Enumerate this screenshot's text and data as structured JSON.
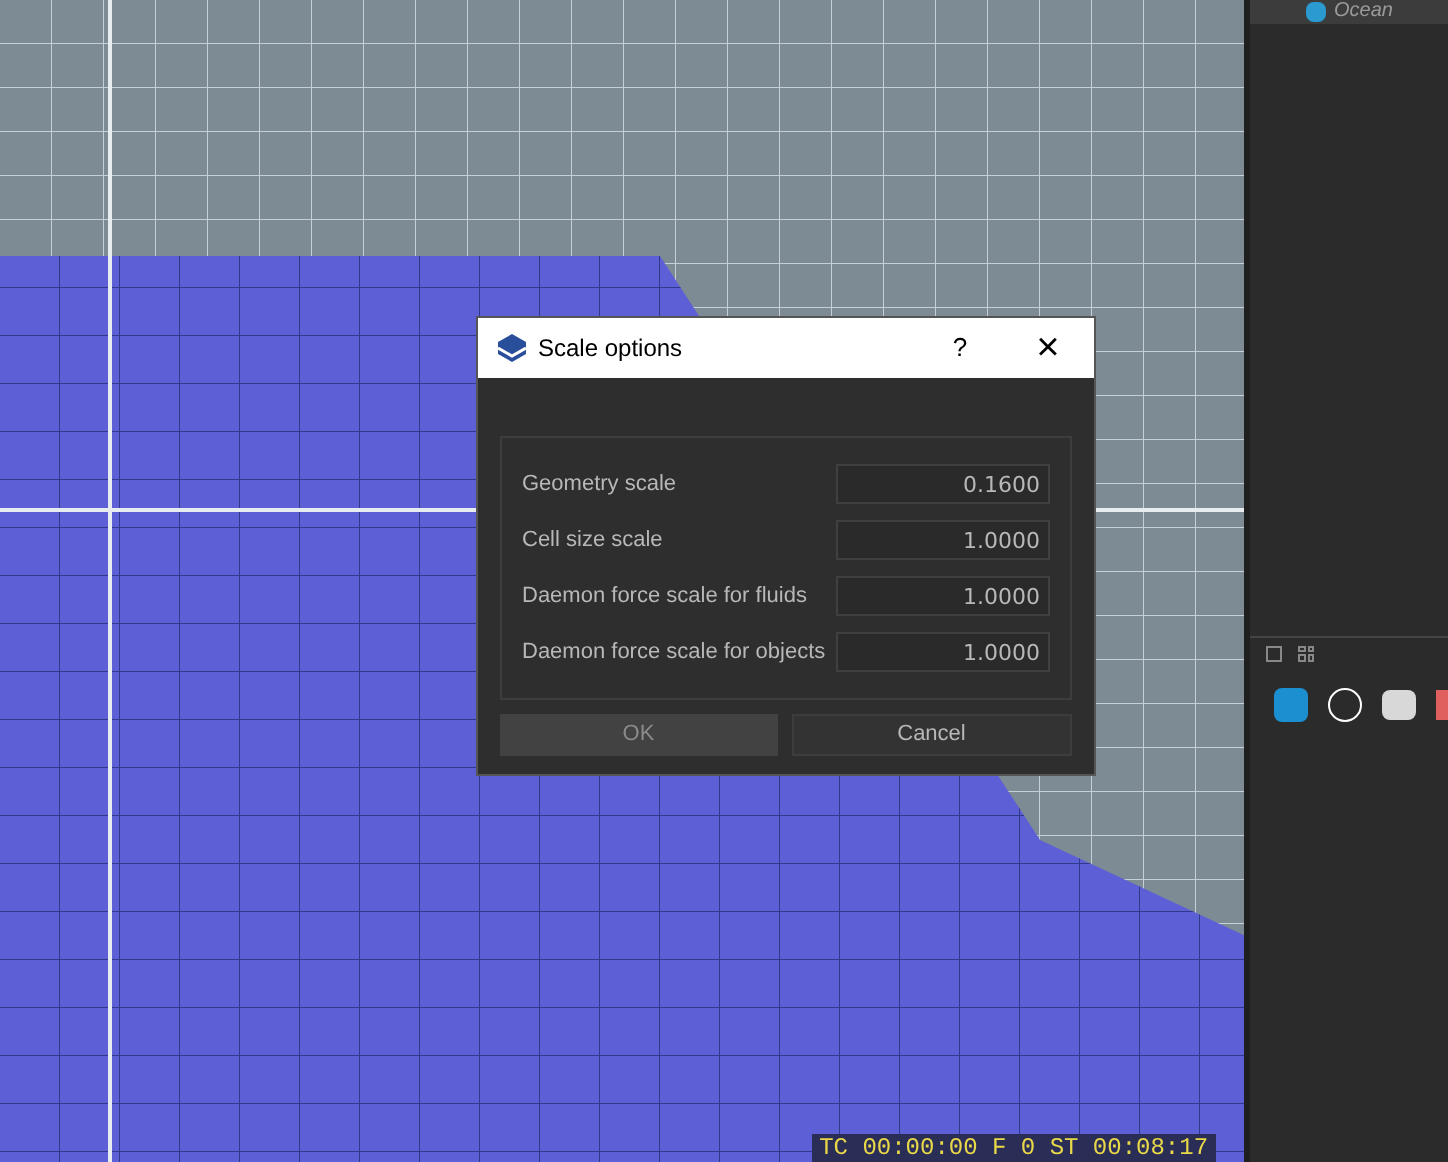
{
  "viewport": {
    "status_overlay": "TC 00:00:00   F 0   ST 00:08:17"
  },
  "side_panel": {
    "item_label": "Ocean"
  },
  "dialog": {
    "title": "Scale options",
    "help": "?",
    "close": "×",
    "fields": [
      {
        "label": "Geometry scale",
        "value": "0.1600"
      },
      {
        "label": "Cell size scale",
        "value": "1.0000"
      },
      {
        "label": "Daemon force scale for fluids",
        "value": "1.0000"
      },
      {
        "label": "Daemon force scale for objects",
        "value": "1.0000"
      }
    ],
    "buttons": [
      {
        "label": "OK",
        "selected": true
      },
      {
        "label": "Cancel",
        "selected": false
      }
    ]
  }
}
